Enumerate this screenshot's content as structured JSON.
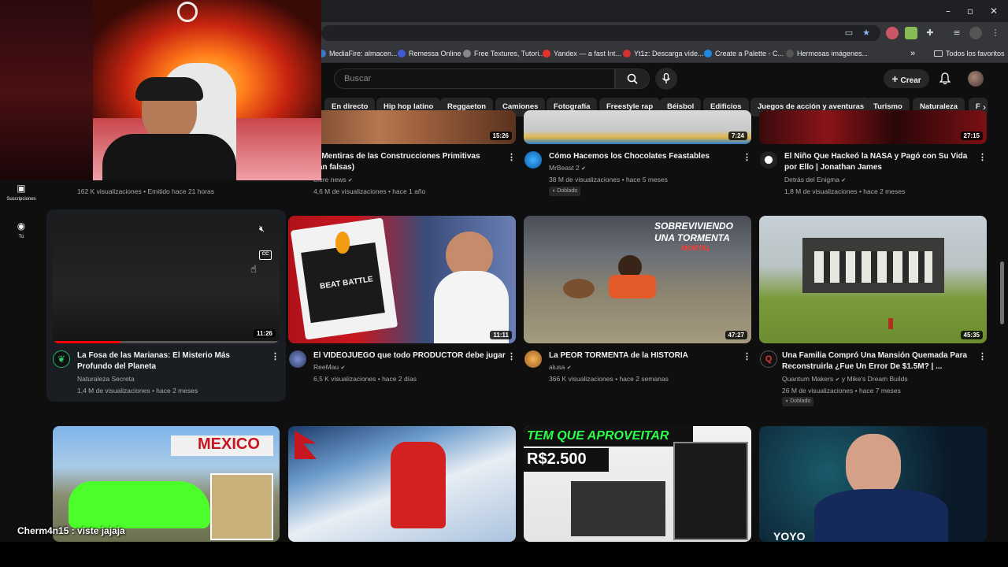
{
  "browser": {
    "window_controls": [
      "–",
      "▫",
      "✕"
    ],
    "bookmarks": [
      {
        "label": "MediaFire: almacen...",
        "color": "#3a79c9"
      },
      {
        "label": "Remessa Online",
        "color": "#3f5bd6"
      },
      {
        "label": "Free Textures, Tutori...",
        "color": "#888888"
      },
      {
        "label": "Yandex — a fast Int...",
        "color": "#e5332a"
      },
      {
        "label": "Yt1z: Descarga víde...",
        "color": "#d3302f"
      },
      {
        "label": "Create a Palette - C...",
        "color": "#1e88e5"
      },
      {
        "label": "Hermosas imágenes...",
        "color": "#555555"
      }
    ],
    "bookmarks_more": "»",
    "all_bookmarks": "Todos los favoritos"
  },
  "header": {
    "search_placeholder": "Buscar",
    "create_label": "Crear"
  },
  "chips": [
    "En directo",
    "Hip hop latino",
    "Reggaeton",
    "Camiones",
    "Fotografía",
    "Freestyle rap",
    "Béisbol",
    "Edificios",
    "Juegos de acción y aventuras",
    "Turismo",
    "Naturaleza",
    "F"
  ],
  "rail": [
    {
      "label": "Suscripciones",
      "icon": "subscriptions-icon"
    },
    {
      "label": "Tú",
      "icon": "you-icon"
    }
  ],
  "row0": [
    {
      "title_line2": "",
      "channel": "",
      "meta": "162 K visualizaciones • Emitido hace 21 horas"
    },
    {
      "title": "s Mentiras de las Construcciones Primitivas",
      "title_line2": "ran falsas)",
      "channel": "efere news",
      "meta": "4,6 M de visualizaciones • hace 1 año",
      "duration": "15:26"
    },
    {
      "title": "Cómo Hacemos los Chocolates Feastables",
      "channel": "MrBeast 2",
      "meta": "38 M de visualizaciones • hace 5 meses",
      "badge": "Doblado",
      "duration": "7:24"
    },
    {
      "title": "El Niño Que Hackeó la NASA y Pagó con Su Vida",
      "title_line2": "por Ello | Jonathan James",
      "channel": "Detrás del Enigma",
      "meta": "1,8 M de visualizaciones • hace 2 meses",
      "duration": "27:15"
    }
  ],
  "row1": [
    {
      "title": "La Fosa de las Marianas: El Misterio Más",
      "title_line2": "Profundo del Planeta",
      "channel": "Naturaleza Secreta",
      "meta": "1,4 M de visualizaciones • hace 2 meses",
      "duration": "11:26",
      "progress": 0.3
    },
    {
      "title": "El VIDEOJUEGO que todo PRODUCTOR debe jugar",
      "channel": "ReeMau",
      "meta": "6,5 K visualizaciones • hace 2 días",
      "duration": "11:11",
      "overlay": "BEAT BATTLE"
    },
    {
      "title": "La PEOR TORMENTA de la HISTORIA",
      "channel": "alusa",
      "meta": "366 K visualizaciones • hace 2 semanas",
      "duration": "47:27",
      "overlay1": "SOBREVIVIENDO",
      "overlay2": "UNA TORMENTA",
      "overlay3": "MORTAL"
    },
    {
      "title": "Una Familia Compró Una Mansión Quemada Para",
      "title_line2": "Reconstruirla ¿Fue Un Error De $1.5M? | ...",
      "channel": "Quantum Makers",
      "channel_extra": "y Mike's Dream Builds",
      "meta": "26 M de visualizaciones • hace 7 meses",
      "badge": "Doblado",
      "duration": "45:35"
    }
  ],
  "row2": [
    {
      "overlay": "MEXICO"
    },
    {},
    {
      "overlay1": "TEM QUE APROVEITAR",
      "overlay2": "R$2.500"
    },
    {
      "overlay": "YOYO"
    }
  ],
  "chat": {
    "text": "Cherm4n15 : viste jajaja"
  },
  "colors": {
    "accent_red": "#ff0000",
    "background": "#0f0f0f",
    "chip": "#272727",
    "muted_text": "#aaaaaa"
  }
}
